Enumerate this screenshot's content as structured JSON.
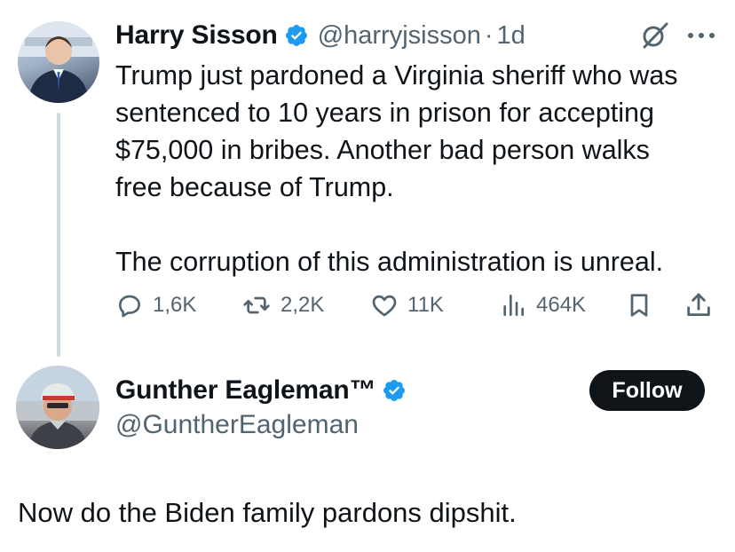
{
  "tweet": {
    "author": {
      "name": "Harry Sisson",
      "handle": "@harryjsisson",
      "verified": true
    },
    "separator": "·",
    "time": "1d",
    "text_lines": [
      "Trump just pardoned a Virginia sheriff who was",
      "sentenced to 10 years in prison for accepting",
      "$75,000 in bribes. Another bad person walks",
      "free because of Trump."
    ],
    "text_line_2": "The corruption of this administration is unreal.",
    "metrics": {
      "replies": "1,6K",
      "reposts": "2,2K",
      "likes": "11K",
      "views": "464K"
    }
  },
  "reply": {
    "author": {
      "name": "Gunther Eagleman™",
      "handle": "@GuntherEagleman",
      "verified": true
    },
    "follow_label": "Follow",
    "text": "Now do the Biden family pardons dipshit."
  },
  "colors": {
    "text": "#0f1419",
    "secondary": "#536471",
    "verified_blue": "#1d9bf0",
    "thread_line": "#cfd9de",
    "follow_bg": "#0f1419"
  },
  "icons": [
    "verified-badge-icon",
    "grok-icon",
    "more-icon",
    "reply-icon",
    "repost-icon",
    "like-icon",
    "views-icon",
    "bookmark-icon",
    "share-icon"
  ]
}
